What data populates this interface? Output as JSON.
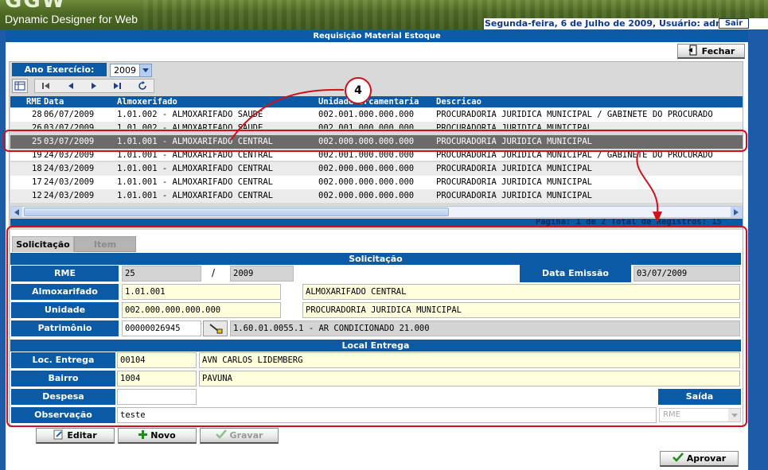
{
  "app": {
    "logo_text": "GGW",
    "logo_subtitle": "Dynamic Designer for Web",
    "date_user": "Segunda-feira, 6 de Julho de 2009, Usuário: admin",
    "logout_label": "Sair",
    "page_title": "Requisição Material Estoque"
  },
  "toolbar": {
    "close_label": "Fechar"
  },
  "filter": {
    "year_label": "Ano Exercício:",
    "year_value": "2009"
  },
  "grid": {
    "columns": [
      "RME",
      "Data",
      "Almoxerifado",
      "Unidade Orcamentaria",
      "Descricao"
    ],
    "rows": [
      {
        "rme": "28",
        "data": "06/07/2009",
        "almox": "1.01.002 - ALMOXARIFADO SAUDE",
        "unidade": "002.001.000.000.000",
        "descricao": "PROCURADORIA JURIDICA MUNICIPAL / GABINETE DO PROCURADO"
      },
      {
        "rme": "26",
        "data": "03/07/2009",
        "almox": "1.01.002 - ALMOXARIFADO SAUDE",
        "unidade": "002.001.000.000.000",
        "descricao": "PROCURADORIA JURIDICA MUNICIPAL"
      },
      {
        "rme": "25",
        "data": "03/07/2009",
        "almox": "1.01.001 - ALMOXARIFADO CENTRAL",
        "unidade": "002.000.000.000.000",
        "descricao": "PROCURADORIA JURIDICA MUNICIPAL"
      },
      {
        "rme": "19",
        "data": "24/03/2009",
        "almox": "1.01.001 - ALMOXARIFADO CENTRAL",
        "unidade": "002.001.000.000.000",
        "descricao": "PROCURADORIA JURIDICA MUNICIPAL / GABINETE DO PROCURADO"
      },
      {
        "rme": "18",
        "data": "24/03/2009",
        "almox": "1.01.001 - ALMOXARIFADO CENTRAL",
        "unidade": "002.000.000.000.000",
        "descricao": "PROCURADORIA JURIDICA MUNICIPAL"
      },
      {
        "rme": "17",
        "data": "24/03/2009",
        "almox": "1.01.001 - ALMOXARIFADO CENTRAL",
        "unidade": "002.000.000.000.000",
        "descricao": "PROCURADORIA JURIDICA MUNICIPAL"
      },
      {
        "rme": "12",
        "data": "24/03/2009",
        "almox": "1.01.001 - ALMOXARIFADO CENTRAL",
        "unidade": "002.000.000.000.000",
        "descricao": "PROCURADORIA JURIDICA MUNICIPAL"
      }
    ],
    "selected_row": 2,
    "paging_text": "Página: 1 de 2 Total de Registros: 15"
  },
  "annotation": {
    "number": "4"
  },
  "tabs": {
    "solicitacao": "Solicitação",
    "item": "Item"
  },
  "form": {
    "section_solicitacao": "Solicitação",
    "rme_label": "RME",
    "rme_value": "25",
    "rme_separator": "/",
    "rme_year": "2009",
    "data_emissao_label": "Data Emissão",
    "data_emissao_value": "03/07/2009",
    "almox_label": "Almoxarifado",
    "almox_code": "1.01.001",
    "almox_name": "ALMOXARIFADO CENTRAL",
    "unidade_label": "Unidade Orçamentária",
    "unidade_code": "002.000.000.000.000",
    "unidade_name": "PROCURADORIA JURIDICA MUNICIPAL",
    "patrimonio_label": "Patrimônio",
    "patrimonio_value": "00000026945",
    "patrimonio_desc": "1.60.01.0055.1  - AR CONDICIONADO 21.000",
    "section_local": "Local Entrega",
    "loc_entrega_label": "Loc. Entrega",
    "loc_entrega_code": "00104",
    "loc_entrega_name": "AVN CARLOS LIDEMBERG",
    "bairro_label": "Bairro",
    "bairro_code": "1004",
    "bairro_name": "PAVUNA",
    "despesa_label": "Despesa",
    "despesa_value": "",
    "saida_label": "Saída",
    "observacao_label": "Observação",
    "observacao_value": "teste",
    "saida_value": "RME"
  },
  "actions": {
    "editar": "Editar",
    "novo": "Novo",
    "gravar": "Gravar",
    "aprovar": "Aprovar"
  },
  "colors": {
    "accent_blue": "#0b5aa6",
    "highlight_red": "#d0101a",
    "selected_row": "#6b6b6b",
    "field_yellow": "#fefedd"
  }
}
